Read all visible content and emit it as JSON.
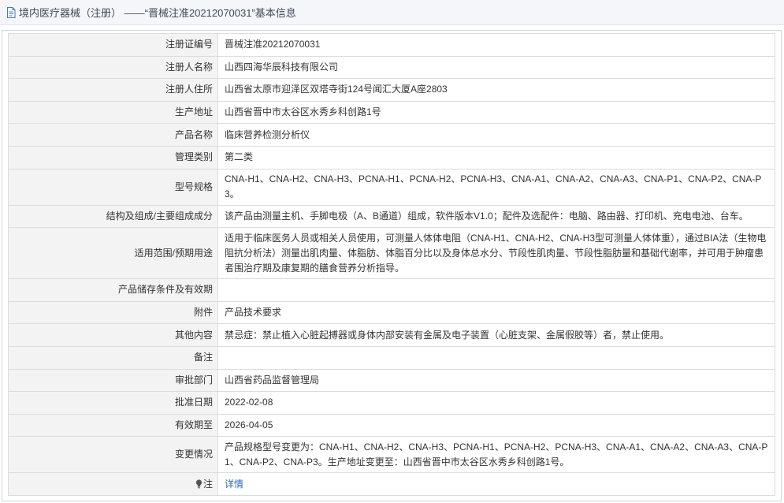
{
  "header": {
    "title": "境内医疗器械（注册） ——“晋械注准20212070031”基本信息"
  },
  "rows": [
    {
      "label": "注册证编号",
      "value": "晋械注准20212070031"
    },
    {
      "label": "注册人名称",
      "value": "山西四海华辰科技有限公司"
    },
    {
      "label": "注册人住所",
      "value": "山西省太原市迎泽区双塔寺街124号闻汇大厦A座2803"
    },
    {
      "label": "生产地址",
      "value": "山西省晋中市太谷区水秀乡科创路1号"
    },
    {
      "label": "产品名称",
      "value": "临床营养检测分析仪"
    },
    {
      "label": "管理类别",
      "value": "第二类"
    },
    {
      "label": "型号规格",
      "value": "CNA-H1、CNA-H2、CNA-H3、PCNA-H1、PCNA-H2、PCNA-H3、CNA-A1、CNA-A2、CNA-A3、CNA-P1、CNA-P2、CNA-P3。"
    },
    {
      "label": "结构及组成/主要组成成分",
      "value": "该产品由测量主机、手脚电极（A、B通道）组成，软件版本V1.0；配件及选配件：电脑、路由器、打印机、充电电池、台车。"
    },
    {
      "label": "适用范围/预期用途",
      "value": "适用于临床医务人员或相关人员使用，可测量人体体电阻（CNA-H1、CNA-H2、CNA-H3型可测量人体体重），通过BIA法（生物电阻抗分析法）测量出肌肉量、体脂肪、体脂百分比以及身体总水分、节段性肌肉量、节段性脂肪量和基础代谢率，并可用于肿瘤患者围治疗期及康复期的膳食营养分析指导。"
    },
    {
      "label": "产品储存条件及有效期",
      "value": ""
    },
    {
      "label": "附件",
      "value": "产品技术要求"
    },
    {
      "label": "其他内容",
      "value": "禁忌症：禁止植入心脏起搏器或身体内部安装有金属及电子装置（心脏支架、金属假胶等）者，禁止使用。"
    },
    {
      "label": "备注",
      "value": ""
    },
    {
      "label": "审批部门",
      "value": "山西省药品监督管理局"
    },
    {
      "label": "批准日期",
      "value": "2022-02-08"
    },
    {
      "label": "有效期至",
      "value": "2026-04-05"
    },
    {
      "label": "变更情况",
      "value": "产品规格型号变更为：CNA-H1、CNA-H2、CNA-H3、PCNA-H1、PCNA-H2、PCNA-H3、CNA-A1、CNA-A2、CNA-A3、CNA-P1、CNA-P2、CNA-P3。生产地址变更至：山西省晋中市太谷区水秀乡科创路1号。"
    }
  ],
  "note": {
    "label": "注",
    "link_text": "详情",
    "icon": "lightbulb-icon"
  },
  "colors": {
    "label_bg": "#f3f3f3",
    "border": "#dcdcdc",
    "link": "#2b6cb0",
    "title_bar_bg": "#f4f6f9"
  }
}
